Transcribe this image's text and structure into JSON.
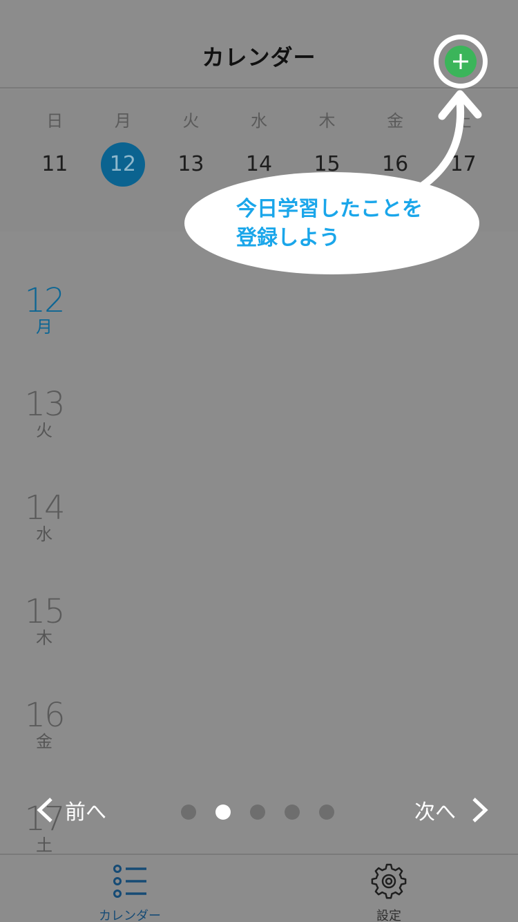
{
  "header": {
    "title": "カレンダー"
  },
  "week": {
    "days_of_week": [
      "日",
      "月",
      "火",
      "水",
      "木",
      "金",
      "土"
    ],
    "dates": [
      "11",
      "12",
      "13",
      "14",
      "15",
      "16",
      "17"
    ],
    "selected_index": 1
  },
  "day_list": [
    {
      "num": "12",
      "label": "月",
      "today": true
    },
    {
      "num": "13",
      "label": "火",
      "today": false
    },
    {
      "num": "14",
      "label": "水",
      "today": false
    },
    {
      "num": "15",
      "label": "木",
      "today": false
    },
    {
      "num": "16",
      "label": "金",
      "today": false
    },
    {
      "num": "17",
      "label": "土",
      "today": false
    }
  ],
  "pager": {
    "prev_label": "前へ",
    "next_label": "次へ",
    "page_count": 5,
    "active_page": 2
  },
  "callout": {
    "line1": "今日学習したことを",
    "line2": "登録しよう"
  },
  "tabs": [
    {
      "label": "カレンダー",
      "icon": "list-icon"
    },
    {
      "label": "設定",
      "icon": "gear-icon"
    }
  ],
  "colors": {
    "overlay_gray": "#8c8c8c",
    "accent_blue": "#0b6390",
    "add_green": "#3bb55a",
    "callout_text": "#1aa6ea"
  }
}
